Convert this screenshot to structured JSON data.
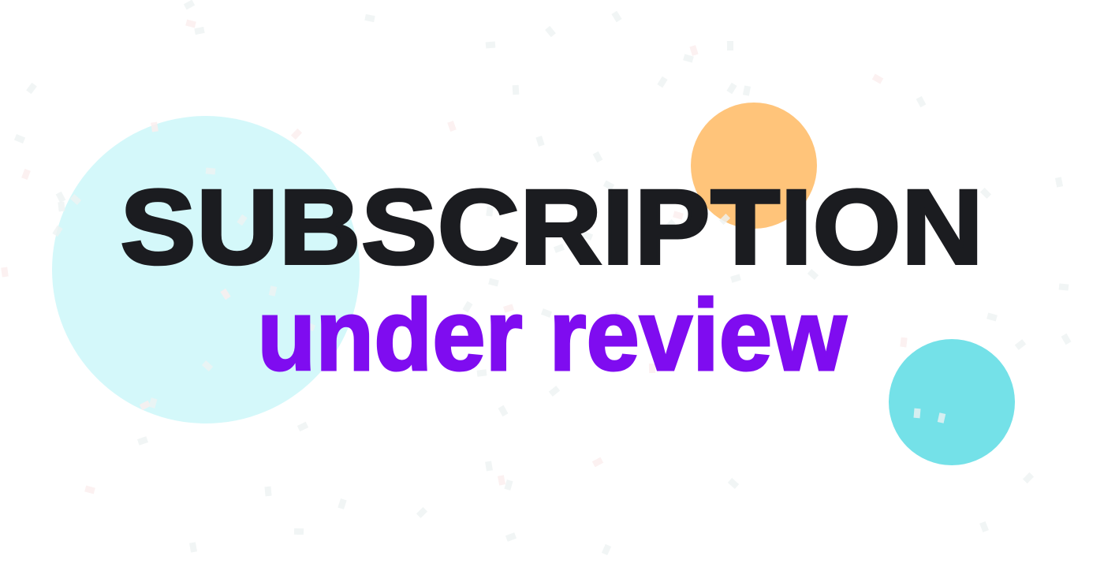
{
  "headline": "SUBSCRIPTION",
  "subheadline": "under review",
  "colors": {
    "headline": "#1b1c20",
    "subheadline": "#7f0cf0",
    "circle_large_light_cyan": "#d4f8fa",
    "circle_orange": "#ffc47a",
    "circle_cyan": "#74e1e8",
    "background": "#ffffff"
  }
}
